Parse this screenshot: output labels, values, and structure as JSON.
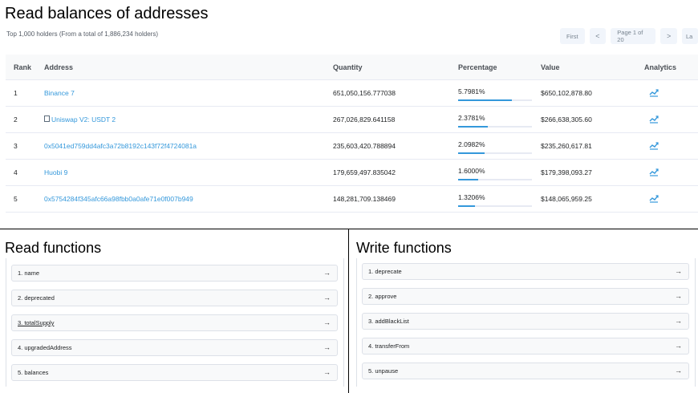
{
  "header": {
    "title": "Read balances of addresses",
    "subtitle": "Top 1,000 holders (From a total of 1,886,234 holders)"
  },
  "pager": {
    "first": "First",
    "prev": "<",
    "page": "Page 1 of 20",
    "next": ">",
    "last": "La"
  },
  "table": {
    "headers": {
      "rank": "Rank",
      "address": "Address",
      "quantity": "Quantity",
      "percentage": "Percentage",
      "value": "Value",
      "analytics": "Analytics"
    },
    "rows": [
      {
        "rank": "1",
        "address": "Binance 7",
        "quantity": "651,050,156.777038",
        "percentage": "5.7981%",
        "pct": 0.7246,
        "value": "$650,102,878.80",
        "doc": false
      },
      {
        "rank": "2",
        "address": "Uniswap V2: USDT 2",
        "quantity": "267,026,829.641158",
        "percentage": "2.3781%",
        "pct": 0.4,
        "value": "$266,638,305.60",
        "doc": true
      },
      {
        "rank": "3",
        "address": "0x5041ed759dd4afc3a72b8192c143f72f4724081a",
        "quantity": "235,603,420.788894",
        "percentage": "2.0982%",
        "pct": 0.36,
        "value": "$235,260,617.81",
        "doc": false
      },
      {
        "rank": "4",
        "address": "Huobi 9",
        "quantity": "179,659,497.835042",
        "percentage": "1.6000%",
        "pct": 0.27,
        "value": "$179,398,093.27",
        "doc": false
      },
      {
        "rank": "5",
        "address": "0x5754284f345afc66a98fbb0a0afe71e0f007b949",
        "quantity": "148,281,709.138469",
        "percentage": "1.3206%",
        "pct": 0.23,
        "value": "$148,065,959.25",
        "doc": false
      }
    ]
  },
  "read_functions": {
    "title": "Read functions",
    "items": [
      {
        "label": "1. name",
        "underline": false
      },
      {
        "label": "2. deprecated",
        "underline": false
      },
      {
        "label": "3. totalSupply",
        "underline": true
      },
      {
        "label": "4. upgradedAddress",
        "underline": false
      },
      {
        "label": "5. balances",
        "underline": false
      }
    ]
  },
  "write_functions": {
    "title": "Write functions",
    "items": [
      {
        "label": "1. deprecate"
      },
      {
        "label": "2. approve"
      },
      {
        "label": "3. addBlackList"
      },
      {
        "label": "4. transferFrom"
      },
      {
        "label": "5. unpause"
      }
    ]
  },
  "icons": {
    "analytics": "analytics-chart-icon",
    "arrow": "arrow-right-icon",
    "doc": "document-icon"
  },
  "colors": {
    "link": "#3498db",
    "accent_bar": "#3498db"
  }
}
